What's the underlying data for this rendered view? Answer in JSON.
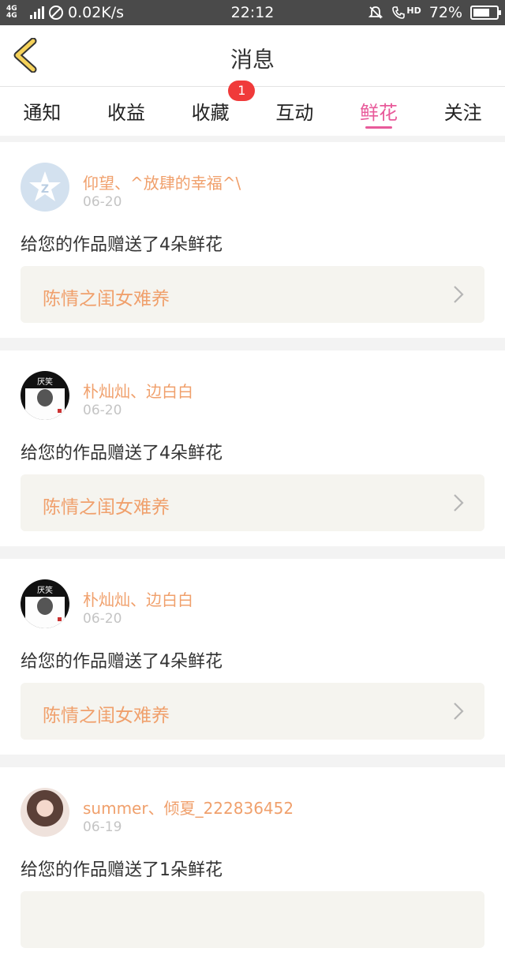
{
  "status_bar": {
    "network": "4G 4G",
    "speed": "0.02K/s",
    "time": "22:12",
    "hd": "HD",
    "battery_percent": "72%",
    "battery_level": 0.72
  },
  "header": {
    "title": "消息",
    "back_icon": "chevron-left-icon"
  },
  "tabs": [
    {
      "label": "通知",
      "active": false
    },
    {
      "label": "收益",
      "active": false
    },
    {
      "label": "收藏",
      "active": false,
      "badge": "1"
    },
    {
      "label": "互动",
      "active": false
    },
    {
      "label": "鲜花",
      "active": true
    },
    {
      "label": "关注",
      "active": false
    }
  ],
  "colors": {
    "accent": "#e85a9a",
    "name_orange": "#f0a06c",
    "badge_red": "#f03a3a"
  },
  "messages": [
    {
      "avatar": "qq-star-avatar",
      "users": "仰望、^放肆的幸福^\\",
      "date": "06-20",
      "text": "给您的作品赠送了4朵鲜花",
      "work_title": "陈情之闺女难养"
    },
    {
      "avatar": "ink-avatar",
      "avatar_text": "厌笑",
      "users": "朴灿灿、边白白",
      "date": "06-20",
      "text": "给您的作品赠送了4朵鲜花",
      "work_title": "陈情之闺女难养"
    },
    {
      "avatar": "ink-avatar",
      "avatar_text": "厌笑",
      "users": "朴灿灿、边白白",
      "date": "06-20",
      "text": "给您的作品赠送了4朵鲜花",
      "work_title": "陈情之闺女难养"
    },
    {
      "avatar": "girl-avatar",
      "users": "summer、倾夏_222836452",
      "date": "06-19",
      "text": "给您的作品赠送了1朵鲜花",
      "work_title": ""
    }
  ]
}
